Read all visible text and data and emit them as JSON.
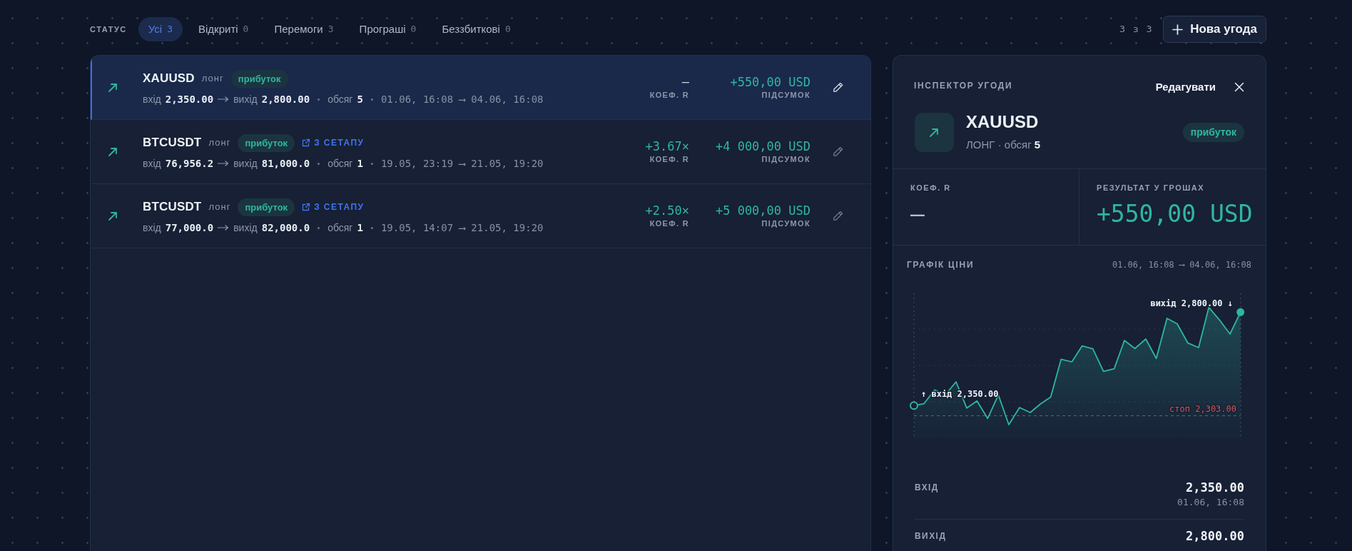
{
  "filter": {
    "label": "СТАТУС",
    "tabs": [
      {
        "label": "Усі",
        "count": "3",
        "selected": true
      },
      {
        "label": "Відкриті",
        "count": "0",
        "selected": false
      },
      {
        "label": "Перемоги",
        "count": "3",
        "selected": false
      },
      {
        "label": "Програші",
        "count": "0",
        "selected": false
      },
      {
        "label": "Беззбиткові",
        "count": "0",
        "selected": false
      }
    ]
  },
  "toolbar": {
    "counter": "3 з 3",
    "new_button": "Нова угода"
  },
  "trades": [
    {
      "symbol": "XAUUSD",
      "side": "лонг",
      "badge": "прибуток",
      "selected": true,
      "entry_label": "вхід",
      "entry": "2,350.00",
      "exit_label": "вихід",
      "exit": "2,800.00",
      "volume_label": "обсяг",
      "volume": "5",
      "period": "01.06, 16:08 ⟶ 04.06, 16:08",
      "r_value": "—",
      "r_positive": false,
      "r_label": "КОЕФ. R",
      "result": "+550,00 USD",
      "result_label": "ПІДСУМОК"
    },
    {
      "symbol": "BTCUSDT",
      "side": "лонг",
      "badge": "прибуток",
      "setup_link": "З СЕТАПУ",
      "selected": false,
      "entry_label": "вхід",
      "entry": "76,956.2",
      "exit_label": "вихід",
      "exit": "81,000.0",
      "volume_label": "обсяг",
      "volume": "1",
      "period": "19.05, 23:19 ⟶ 21.05, 19:20",
      "r_value": "+3.67×",
      "r_positive": true,
      "r_label": "КОЕФ. R",
      "result": "+4 000,00 USD",
      "result_label": "ПІДСУМОК"
    },
    {
      "symbol": "BTCUSDT",
      "side": "лонг",
      "badge": "прибуток",
      "setup_link": "З СЕТАПУ",
      "selected": false,
      "entry_label": "вхід",
      "entry": "77,000.0",
      "exit_label": "вихід",
      "exit": "82,000.0",
      "volume_label": "обсяг",
      "volume": "1",
      "period": "19.05, 14:07 ⟶ 21.05, 19:20",
      "r_value": "+2.50×",
      "r_positive": true,
      "r_label": "КОЕФ. R",
      "result": "+5 000,00 USD",
      "result_label": "ПІДСУМОК"
    }
  ],
  "inspector": {
    "title": "ІНСПЕКТОР УГОДИ",
    "edit": "Редагувати",
    "symbol": "XAUUSD",
    "subtitle": "ЛОНГ · обсяг **5**",
    "badge": "прибуток",
    "stats": [
      {
        "label": "КОЕФ. R",
        "value": "—",
        "positive": false
      },
      {
        "label": "РЕЗУЛЬТАТ У ГРОШАХ",
        "value": "+550,00 USD",
        "positive": true
      }
    ],
    "chart": {
      "title": "ГРАФІК ЦІНИ",
      "range": "01.06, 16:08 ⟶ 04.06, 16:08",
      "entry_label": "↑ вхід 2,350.00",
      "exit_label": "вихід 2,800.00 ↓",
      "stop_label": "стоп 2,303.00"
    },
    "details": [
      {
        "label": "ВХІД",
        "value": "2,350.00",
        "time": "01.06, 16:08"
      },
      {
        "label": "ВИХІД",
        "value": "2,800.00"
      }
    ]
  }
}
